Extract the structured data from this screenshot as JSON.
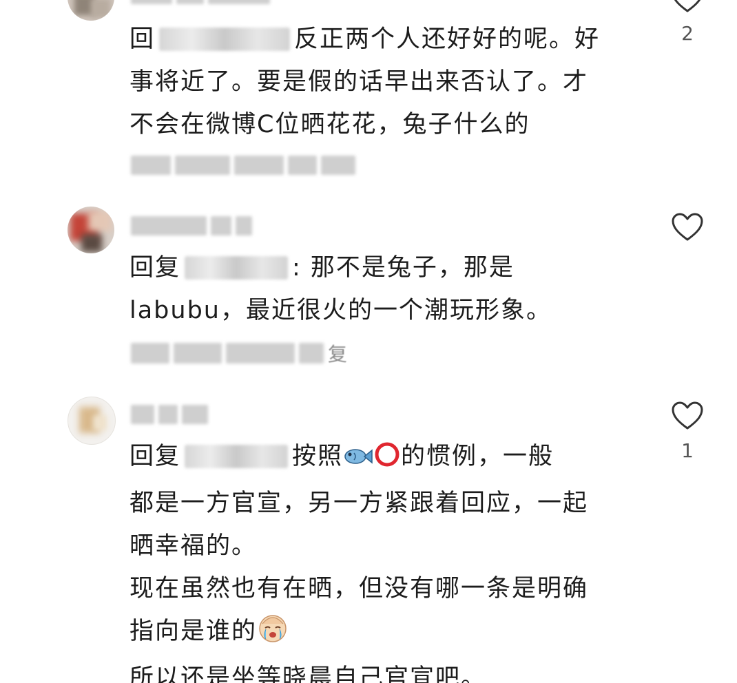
{
  "comments": [
    {
      "reply_prefix": "回",
      "lines": [
        "反正两个人还好好的呢。好",
        "事将近了。要是假的话早出来否认了。才",
        "不会在微博C位晒花花，兔子什么的"
      ],
      "like_count": "2"
    },
    {
      "reply_prefix": "回复",
      "line1_after": ": 那不是兔子，那是",
      "lines": [
        "labubu，最近很火的一个潮玩形象。"
      ],
      "meta_suffix": "复",
      "like_count": ""
    },
    {
      "reply_prefix": "回复",
      "line1_mid": "按照",
      "line1_end": "的惯例，一般",
      "lines": [
        "都是一方官宣，另一方紧跟着回应，一起",
        "晒幸福的。",
        "现在虽然也有在晒，但没有哪一条是明确"
      ],
      "line_emoji_prefix": "指向是谁的",
      "last_line": "所以还是坐等晓晨自己官宣吧。",
      "like_count": "1",
      "icons": [
        "fish-emoji",
        "red-circle-emoji",
        "crying-face-emoji"
      ]
    }
  ],
  "colors": {
    "text": "#1c1c1c",
    "muted": "#555555",
    "heart": "#333333"
  }
}
